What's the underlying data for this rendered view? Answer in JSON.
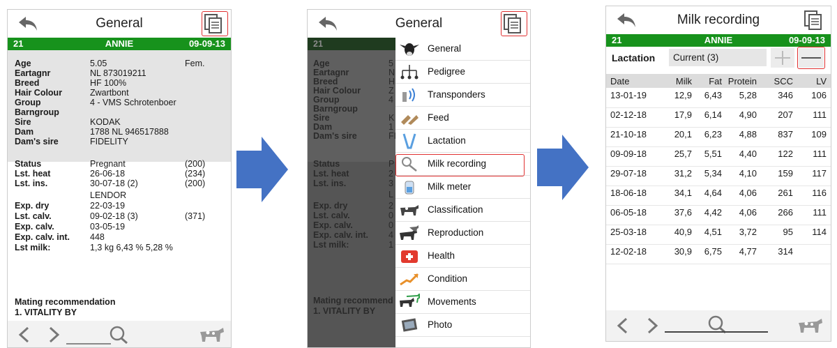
{
  "panel1": {
    "title": "General",
    "header": {
      "id": "21",
      "name": "ANNIE",
      "date": "09-09-13"
    },
    "details": [
      {
        "label": "Age",
        "value": "5.05",
        "extra": "Fem."
      },
      {
        "label": "Eartagnr",
        "value": "NL 873019211",
        "extra": ""
      },
      {
        "label": "Breed",
        "value": "HF 100%",
        "extra": ""
      },
      {
        "label": "Hair Colour",
        "value": "Zwartbont",
        "extra": ""
      },
      {
        "label": "Group",
        "value": "4 - VMS Schrotenboer",
        "extra": ""
      },
      {
        "label": "Barngroup",
        "value": "",
        "extra": ""
      },
      {
        "label": "Sire",
        "value": "KODAK",
        "extra": ""
      },
      {
        "label": "Dam",
        "value": "1788  NL 946517888",
        "extra": ""
      },
      {
        "label": "Dam's sire",
        "value": "FIDELITY",
        "extra": ""
      }
    ],
    "status": [
      {
        "label": "Status",
        "value": "Pregnant",
        "extra": "(200)"
      },
      {
        "label": "Lst. heat",
        "value": "26-06-18",
        "extra": "(234)"
      },
      {
        "label": "Lst. ins.",
        "value": "30-07-18 (2)",
        "extra": "(200)"
      },
      {
        "label": "",
        "value": "LENDOR",
        "extra": ""
      },
      {
        "label": "Exp. dry",
        "value": "22-03-19",
        "extra": ""
      },
      {
        "label": "Lst. calv.",
        "value": "09-02-18 (3)",
        "extra": "(371)"
      },
      {
        "label": "Exp. calv.",
        "value": "03-05-19",
        "extra": ""
      },
      {
        "label": "Exp. calv. int.",
        "value": "448",
        "extra": ""
      },
      {
        "label": "Lst milk:",
        "value": "1,3 kg 6,43 %  5,28 %",
        "extra": ""
      }
    ],
    "mating_title": "Mating recommendation",
    "mating_first": "1. VITALITY BY"
  },
  "panel2": {
    "title": "General",
    "header_id": "21",
    "dim_labels": [
      "Age",
      "Eartagnr",
      "Breed",
      "Hair Colour",
      "Group",
      "Barngroup",
      "Sire",
      "Dam",
      "Dam's sire"
    ],
    "dim_values": [
      "5",
      "N",
      "H",
      "Z",
      "4",
      "",
      "K",
      "1",
      "FI"
    ],
    "dim_status_labels": [
      "Status",
      "Lst. heat",
      "Lst. ins.",
      "",
      "Exp. dry",
      "Lst. calv.",
      "Exp. calv.",
      "Exp. calv. int.",
      "Lst milk:"
    ],
    "dim_status_values": [
      "P",
      "2",
      "3",
      "L",
      "2",
      "0",
      "0",
      "4",
      "1"
    ],
    "mating_title": "Mating recommend",
    "mating_first": "1. VITALITY BY",
    "menu": [
      {
        "label": "General",
        "icon": "cow-head-icon"
      },
      {
        "label": "Pedigree",
        "icon": "pedigree-icon"
      },
      {
        "label": "Transponders",
        "icon": "transponder-icon"
      },
      {
        "label": "Feed",
        "icon": "feed-icon"
      },
      {
        "label": "Lactation",
        "icon": "lactation-icon"
      },
      {
        "label": "Milk recording",
        "icon": "milk-recording-icon"
      },
      {
        "label": "Milk meter",
        "icon": "milk-meter-icon"
      },
      {
        "label": "Classification",
        "icon": "classification-icon"
      },
      {
        "label": "Reproduction",
        "icon": "reproduction-icon"
      },
      {
        "label": "Health",
        "icon": "health-icon"
      },
      {
        "label": "Condition",
        "icon": "condition-icon"
      },
      {
        "label": "Movements",
        "icon": "movements-icon"
      },
      {
        "label": "Photo",
        "icon": "photo-icon"
      }
    ]
  },
  "panel3": {
    "title": "Milk recording",
    "header": {
      "id": "21",
      "name": "ANNIE",
      "date": "09-09-13"
    },
    "lactation_label": "Lactation",
    "lactation_value": "Current (3)",
    "columns": [
      "Date",
      "Milk",
      "Fat",
      "Protein",
      "SCC",
      "LV"
    ],
    "rows": [
      [
        "13-01-19",
        "12,9",
        "6,43",
        "5,28",
        "346",
        "106"
      ],
      [
        "02-12-18",
        "17,9",
        "6,14",
        "4,90",
        "207",
        "111"
      ],
      [
        "21-10-18",
        "20,1",
        "6,23",
        "4,88",
        "837",
        "109"
      ],
      [
        "09-09-18",
        "25,7",
        "5,51",
        "4,40",
        "122",
        "111"
      ],
      [
        "29-07-18",
        "31,2",
        "5,34",
        "4,10",
        "159",
        "117"
      ],
      [
        "18-06-18",
        "34,1",
        "4,64",
        "4,06",
        "261",
        "116"
      ],
      [
        "06-05-18",
        "37,6",
        "4,42",
        "4,06",
        "266",
        "111"
      ],
      [
        "25-03-18",
        "40,9",
        "4,51",
        "3,72",
        "95",
        "114"
      ],
      [
        "12-02-18",
        "30,9",
        "6,75",
        "4,77",
        "314",
        ""
      ]
    ]
  },
  "colors": {
    "green_bar": "#17921c",
    "highlight": "#e03030",
    "arrow": "#4472c4"
  }
}
